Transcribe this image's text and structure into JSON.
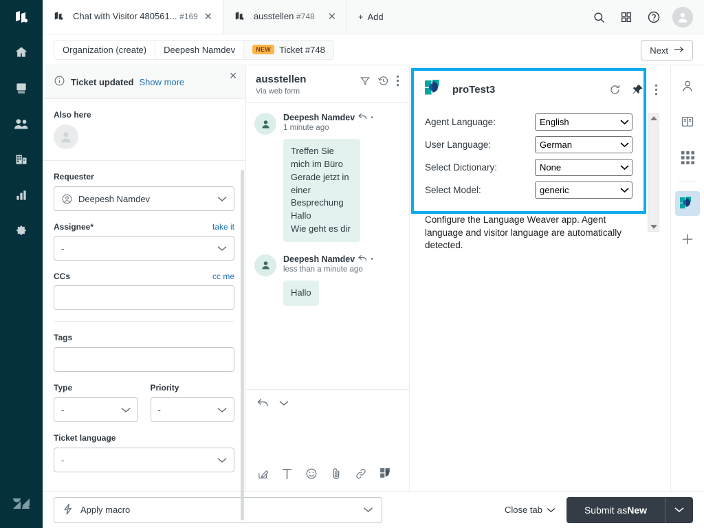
{
  "nav": {
    "logo_icon": "zendesk-product-icon",
    "items": [
      {
        "icon": "home-icon",
        "name": "home"
      },
      {
        "icon": "views-icon",
        "name": "views"
      },
      {
        "icon": "customers-icon",
        "name": "customers"
      },
      {
        "icon": "organizations-icon",
        "name": "organizations"
      },
      {
        "icon": "reporting-icon",
        "name": "reporting"
      },
      {
        "icon": "admin-gear-icon",
        "name": "admin"
      }
    ],
    "bottom_logo_icon": "zendesk-logo-icon"
  },
  "topbar": {
    "tabs": [
      {
        "title": "Chat with Visitor 480561...",
        "subtitle": "#169",
        "icon": "chat-tab-icon",
        "active": true
      },
      {
        "title": "ausstellen",
        "subtitle": "#748",
        "icon": "chat-tab-icon",
        "active": false
      }
    ],
    "add_label": "Add",
    "icons": [
      {
        "name": "search-icon"
      },
      {
        "name": "apps-grid-icon"
      },
      {
        "name": "help-question-icon"
      }
    ],
    "avatar_name": "user-avatar"
  },
  "breadcrumb": {
    "items": [
      {
        "label": "Organization (create)",
        "badge": null,
        "current": false
      },
      {
        "label": "Deepesh Namdev",
        "badge": null,
        "current": false
      },
      {
        "label": "Ticket #748",
        "badge": "NEW",
        "current": true
      }
    ],
    "next_label": "Next"
  },
  "ticket_sidebar": {
    "notice": {
      "title": "Ticket updated",
      "link": "Show more",
      "close_icon": "close-icon",
      "info_icon": "info-circle-icon"
    },
    "also_here_label": "Also here",
    "fields": [
      {
        "label": "Requester",
        "value": "Deepesh Namdev",
        "type": "select",
        "lead_icon": "user-circle-icon",
        "action": null
      },
      {
        "label": "Assignee*",
        "value": "-",
        "type": "select",
        "lead_icon": null,
        "action": "take it"
      },
      {
        "label": "CCs",
        "value": "",
        "type": "input",
        "lead_icon": null,
        "action": "cc me"
      },
      {
        "label": "Tags",
        "value": "",
        "type": "input",
        "lead_icon": null,
        "action": null
      }
    ],
    "type_field": {
      "label": "Type",
      "value": "-"
    },
    "priority_field": {
      "label": "Priority",
      "value": "-"
    },
    "ticket_language_field": {
      "label": "Ticket language",
      "value": "-"
    }
  },
  "conversation": {
    "title": "ausstellen",
    "subtitle": "Via web form",
    "head_icons": [
      {
        "name": "filter-icon"
      },
      {
        "name": "history-clock-icon"
      },
      {
        "name": "more-vertical-icon"
      }
    ],
    "messages": [
      {
        "author": "Deepesh Namdev",
        "time": "1 minute ago",
        "text": "Treffen Sie mich im Büro\nGerade jetzt in einer Besprechung\nHallo\nWie geht es dir",
        "avatar_icon": "person-icon"
      },
      {
        "author": "Deepesh Namdev",
        "time": "less than a minute ago",
        "text": "Hallo",
        "avatar_icon": "person-icon"
      }
    ],
    "composer_icons_top": [
      {
        "name": "reply-arrow-icon"
      },
      {
        "name": "chevron-down-icon"
      }
    ],
    "composer_tools": [
      {
        "name": "compose-edit-icon"
      },
      {
        "name": "text-format-icon"
      },
      {
        "name": "emoji-icon"
      },
      {
        "name": "attachment-clip-icon"
      },
      {
        "name": "link-icon"
      },
      {
        "name": "language-weaver-icon"
      }
    ]
  },
  "app_panel": {
    "highlight_color": "#0caaf0",
    "app_name": "proTest3",
    "logo_icon": "language-weaver-logo-icon",
    "header_icons": [
      {
        "name": "refresh-icon"
      },
      {
        "name": "pin-icon"
      },
      {
        "name": "more-vertical-icon"
      }
    ],
    "rows": [
      {
        "label": "Agent Language:",
        "value": "English"
      },
      {
        "label": "User Language:",
        "value": "German"
      },
      {
        "label": "Select Dictionary:",
        "value": "None"
      },
      {
        "label": "Select Model:",
        "value": "generic"
      }
    ],
    "description": "Configure the Language Weaver app. Agent language and visitor language are automatically detected.",
    "scrollbar": {
      "up_icon": "scroll-up-arrow-icon",
      "down_icon": "scroll-down-arrow-icon"
    }
  },
  "app_rail": {
    "items": [
      {
        "name": "user-profile-icon",
        "active": false
      },
      {
        "name": "knowledge-book-icon",
        "active": false
      },
      {
        "name": "apps-grid-icon",
        "active": false
      }
    ],
    "pinned": [
      {
        "name": "language-weaver-app-icon",
        "active": true
      }
    ],
    "add_icon": "plus-icon"
  },
  "footer": {
    "macro_label": "Apply macro",
    "macro_icon": "lightning-bolt-icon",
    "close_tab_label": "Close tab",
    "submit_prefix": "Submit as ",
    "submit_state": "New"
  }
}
